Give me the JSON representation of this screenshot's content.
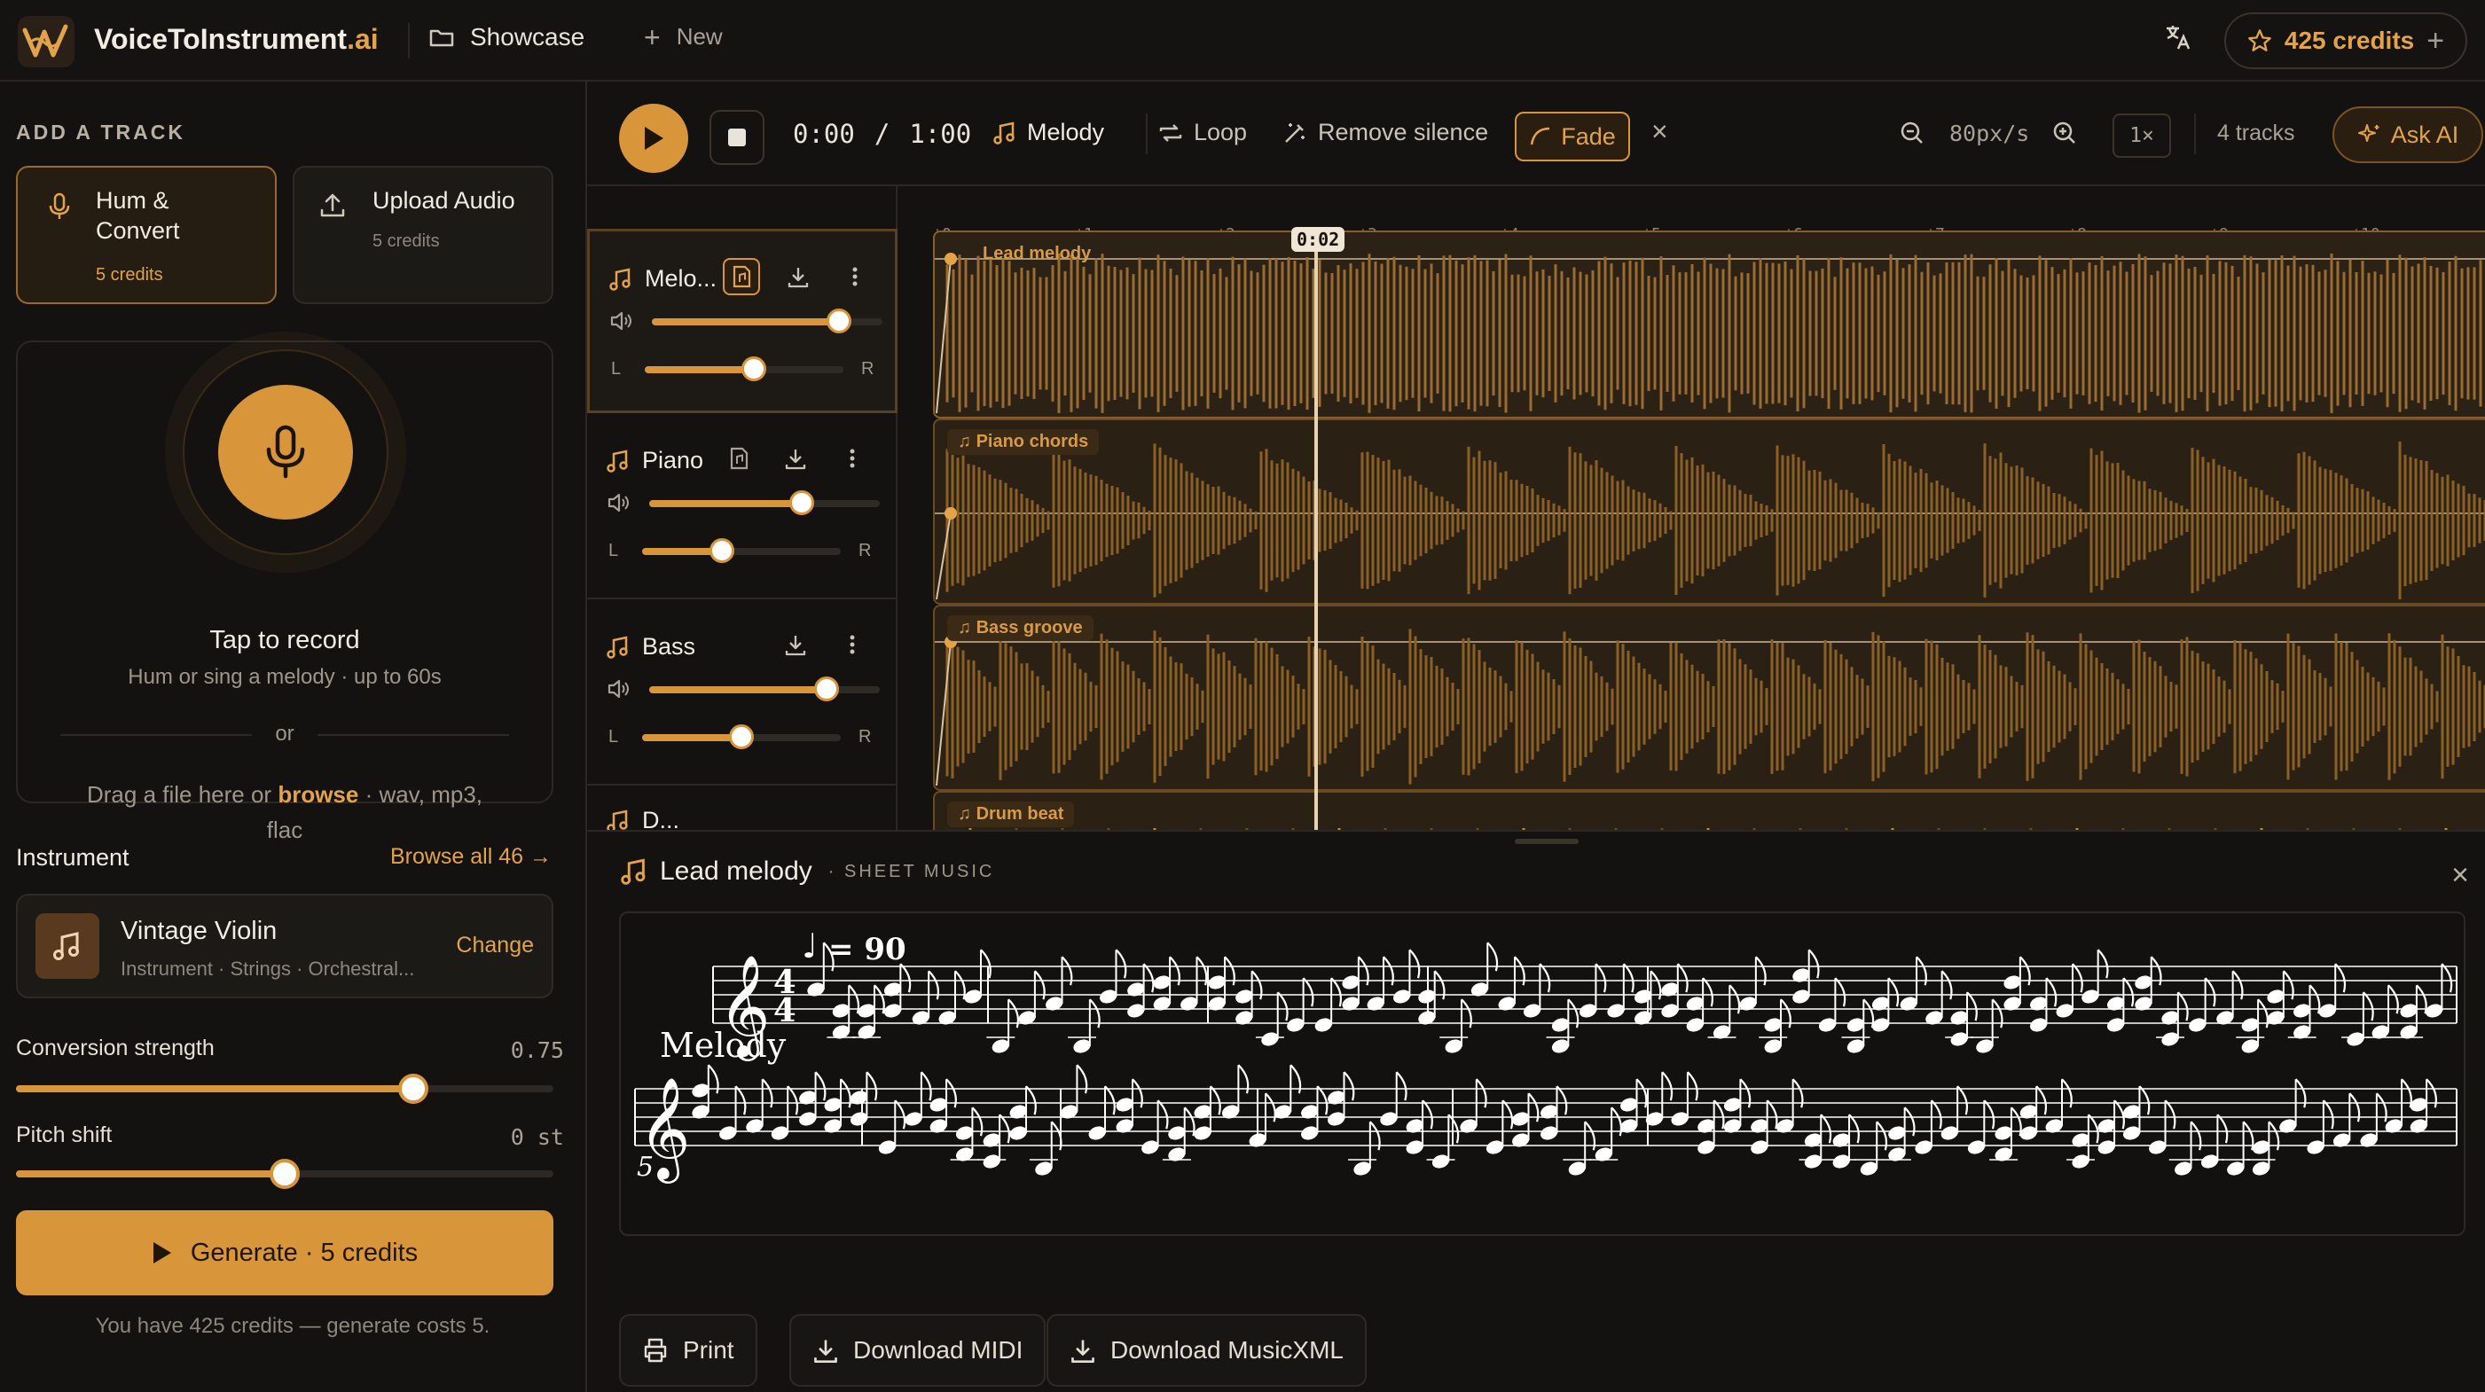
{
  "app": {
    "brand_main": "VoiceToInstrument",
    "brand_suffix": ".ai",
    "nav_showcase": "Showcase",
    "nav_new": "New",
    "credits_label": "425 credits"
  },
  "sidebar": {
    "section_label": "ADD A TRACK",
    "hum": {
      "title": "Hum & Convert",
      "credits": "5 credits"
    },
    "upload": {
      "title": "Upload Audio",
      "credits": "5 credits"
    },
    "record": {
      "title": "Tap to record",
      "hint": "Hum or sing a melody · up to 60s",
      "or": "or",
      "drag_prefix": "Drag a file here or ",
      "browse": "browse",
      "drag_suffix": " · wav, mp3, flac"
    },
    "instrument": {
      "label": "Instrument",
      "browse_all": "Browse all 46 →",
      "name": "Vintage Violin",
      "meta": "Instrument · Strings · Orchestral...",
      "change": "Change"
    },
    "conversion": {
      "label": "Conversion strength",
      "value_text": "0.75",
      "level": 0.75
    },
    "pitch": {
      "label": "Pitch shift",
      "value_text": "0 st",
      "level": 0.5
    },
    "generate_label": "Generate · 5 credits",
    "footnote": "You have 425 credits — generate costs 5."
  },
  "transport": {
    "time_current": "0:00",
    "time_sep": "/",
    "time_total": "1:00",
    "melody": "Melody",
    "loop": "Loop",
    "remove_silence": "Remove silence",
    "fade": "Fade",
    "zoom": "80px/s",
    "speed": "1×",
    "tracks_count": "4 tracks",
    "ask_ai": "Ask AI"
  },
  "tracks": [
    {
      "name": "Melo...",
      "volume": 0.9,
      "pan": 0.55,
      "lane_label": "Lead melody"
    },
    {
      "name": "Piano",
      "volume": 0.66,
      "pan": 0.4,
      "lane_label": "Piano chords"
    },
    {
      "name": "Bass",
      "volume": 0.78,
      "pan": 0.5,
      "lane_label": "Bass groove"
    },
    {
      "name": "D...",
      "lane_label": "Drum beat"
    }
  ],
  "timeline": {
    "ruler_ticks": [
      "0",
      "1",
      "2",
      "3",
      "4",
      "5",
      "6",
      "7",
      "8",
      "9",
      "10"
    ],
    "playhead_label": "0:02",
    "pan_left": "L",
    "pan_right": "R"
  },
  "sheet": {
    "title": "Lead melody",
    "tag": "· SHEET MUSIC",
    "tempo": "= 90",
    "instrument": "Melody",
    "measure_5": "5",
    "print": "Print",
    "download_midi": "Download MIDI",
    "download_xml": "Download MusicXML"
  },
  "colors": {
    "accent": "#d8953a",
    "background": "#141210"
  }
}
